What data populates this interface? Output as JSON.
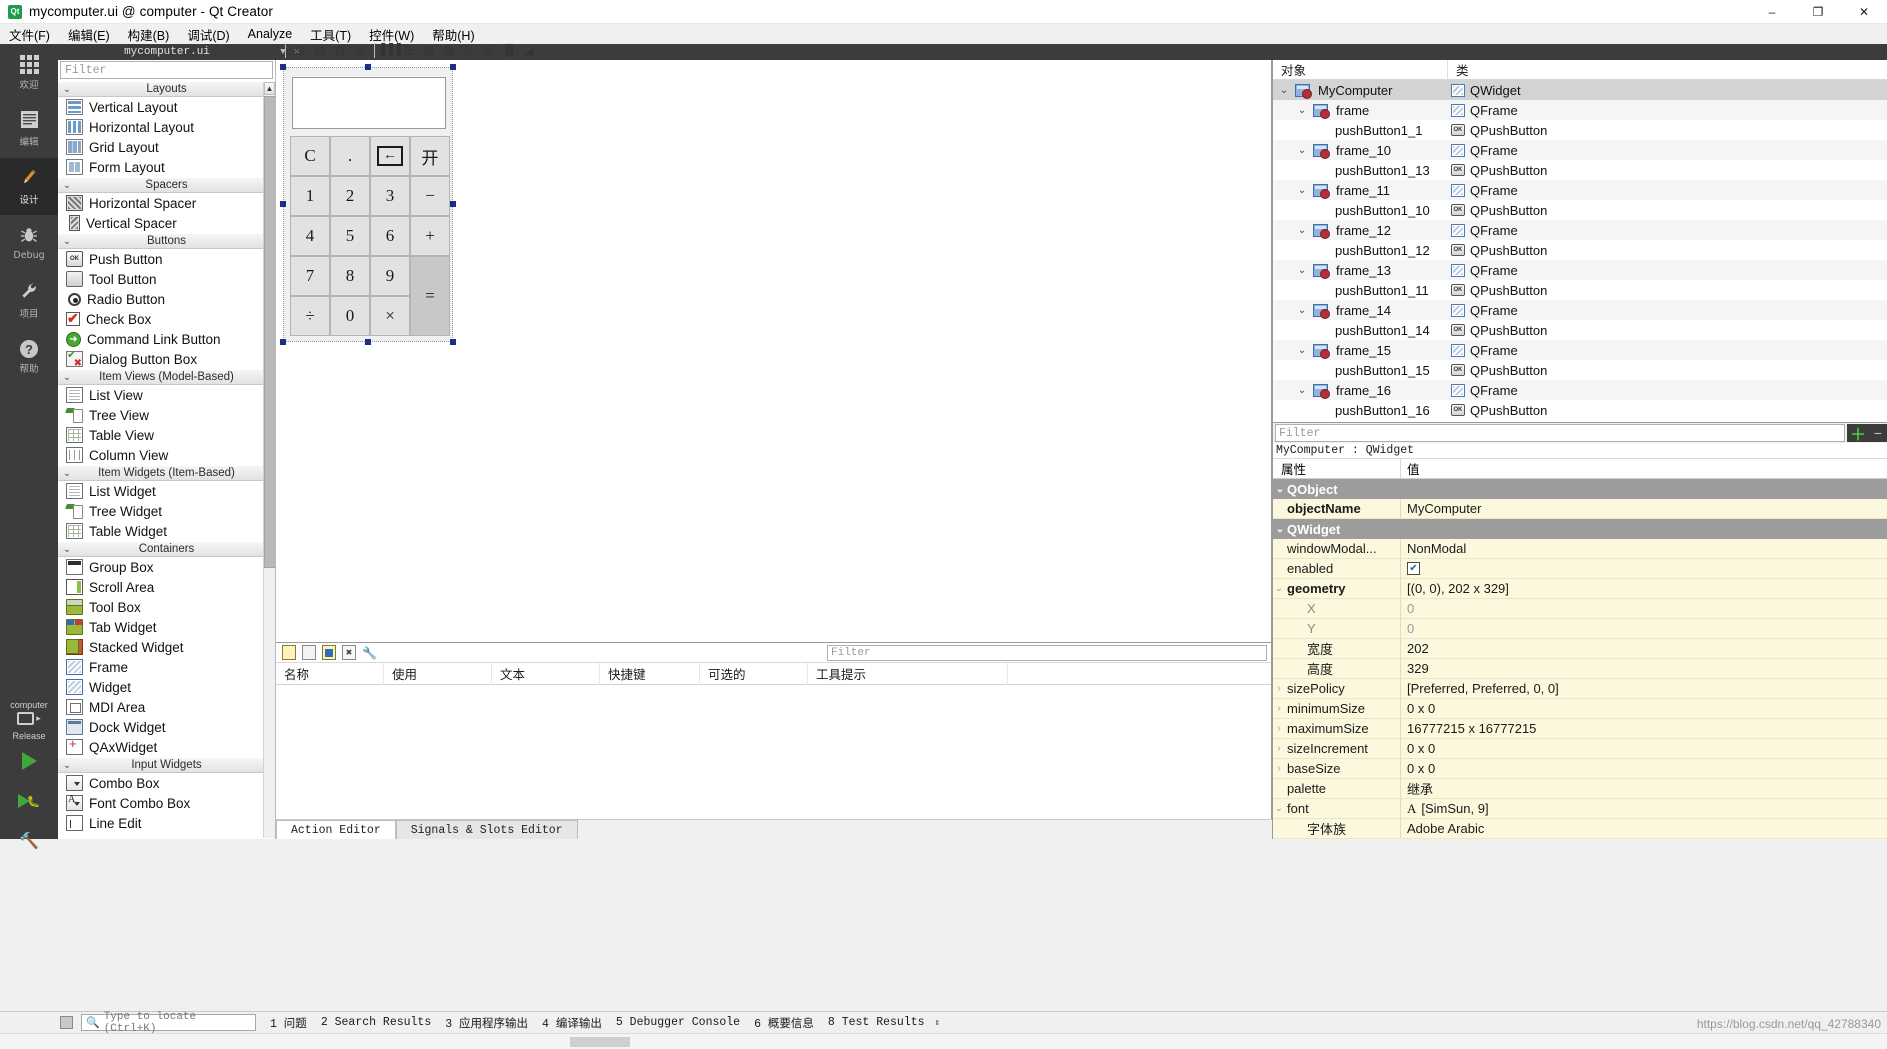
{
  "window": {
    "title": "mycomputer.ui @ computer - Qt Creator",
    "icon": "qt-creator-icon",
    "minimize": "–",
    "maximize": "❐",
    "close": "✕"
  },
  "menubar": [
    {
      "label": "文件(F)"
    },
    {
      "label": "编辑(E)"
    },
    {
      "label": "构建(B)"
    },
    {
      "label": "调试(D)"
    },
    {
      "label": "Analyze"
    },
    {
      "label": "工具(T)"
    },
    {
      "label": "控件(W)"
    },
    {
      "label": "帮助(H)"
    }
  ],
  "modebar": [
    {
      "label": "欢迎",
      "icon": "grid-icon"
    },
    {
      "label": "编辑",
      "icon": "lines-icon"
    },
    {
      "label": "设计",
      "icon": "pencil-icon",
      "active": true
    },
    {
      "label": "Debug",
      "icon": "bug-icon"
    },
    {
      "label": "项目",
      "icon": "wrench-icon"
    },
    {
      "label": "帮助",
      "icon": "question-icon"
    }
  ],
  "kit": {
    "project": "computer",
    "build_config": "Release",
    "run_icon": "run-triangle-icon",
    "debug_icon": "debug-run-icon",
    "build_icon": "hammer-icon"
  },
  "editor_tab": {
    "filename": "mycomputer.ui",
    "dropdown": "▼",
    "close": "✕"
  },
  "designer_toolbar": [
    {
      "name": "edit-widgets-icon",
      "glyph": "▤"
    },
    {
      "name": "edit-signals-slots-icon",
      "glyph": "▨"
    },
    {
      "name": "edit-buddies-icon",
      "glyph": "▧"
    },
    {
      "name": "edit-tab-order-icon",
      "glyph": "②"
    },
    {
      "name": "layout-horizontal-icon",
      "glyph": "▐▐▐"
    },
    {
      "name": "layout-vertical-icon",
      "glyph": "☰"
    },
    {
      "name": "layout-splitter-h-icon",
      "glyph": "▥"
    },
    {
      "name": "layout-splitter-v-icon",
      "glyph": "▤"
    },
    {
      "name": "layout-form-icon",
      "glyph": "░"
    },
    {
      "name": "layout-grid-icon",
      "glyph": "▒"
    },
    {
      "name": "break-layout-icon",
      "glyph": "▓"
    },
    {
      "name": "adjust-size-icon",
      "glyph": "◢"
    }
  ],
  "widgetbox": {
    "filter_placeholder": "Filter",
    "scroll_up": "▲",
    "scroll_down": "▼",
    "categories": [
      {
        "name": "Layouts",
        "chevron": "⌄",
        "items": [
          {
            "label": "Vertical Layout",
            "icon": "vertical-layout-icon",
            "cls": "i-vlayout"
          },
          {
            "label": "Horizontal Layout",
            "icon": "horizontal-layout-icon",
            "cls": "i-hlayout"
          },
          {
            "label": "Grid Layout",
            "icon": "grid-layout-icon",
            "cls": "i-grid"
          },
          {
            "label": "Form Layout",
            "icon": "form-layout-icon",
            "cls": "i-form"
          }
        ]
      },
      {
        "name": "Spacers",
        "chevron": "⌄",
        "items": [
          {
            "label": "Horizontal Spacer",
            "icon": "horizontal-spacer-icon",
            "cls": "i-hspacer"
          },
          {
            "label": "Vertical Spacer",
            "icon": "vertical-spacer-icon",
            "cls": "i-vspacer"
          }
        ]
      },
      {
        "name": "Buttons",
        "chevron": "⌄",
        "items": [
          {
            "label": "Push Button",
            "icon": "push-button-icon",
            "cls": "i-push",
            "text": "OK"
          },
          {
            "label": "Tool Button",
            "icon": "tool-button-icon",
            "cls": "i-tool"
          },
          {
            "label": "Radio Button",
            "icon": "radio-button-icon",
            "cls": "i-radio"
          },
          {
            "label": "Check Box",
            "icon": "check-box-icon",
            "cls": "i-check"
          },
          {
            "label": "Command Link Button",
            "icon": "command-link-button-icon",
            "cls": "i-cmd",
            "text": "➜"
          },
          {
            "label": "Dialog Button Box",
            "icon": "dialog-button-box-icon",
            "cls": "i-dbb"
          }
        ]
      },
      {
        "name": "Item Views (Model-Based)",
        "chevron": "⌄",
        "items": [
          {
            "label": "List View",
            "icon": "list-view-icon",
            "cls": "i-listview"
          },
          {
            "label": "Tree View",
            "icon": "tree-view-icon",
            "cls": "i-treeview"
          },
          {
            "label": "Table View",
            "icon": "table-view-icon",
            "cls": "i-tableview"
          },
          {
            "label": "Column View",
            "icon": "column-view-icon",
            "cls": "i-colview"
          }
        ]
      },
      {
        "name": "Item Widgets (Item-Based)",
        "chevron": "⌄",
        "items": [
          {
            "label": "List Widget",
            "icon": "list-widget-icon",
            "cls": "i-listview"
          },
          {
            "label": "Tree Widget",
            "icon": "tree-widget-icon",
            "cls": "i-treeview"
          },
          {
            "label": "Table Widget",
            "icon": "table-widget-icon",
            "cls": "i-tableview"
          }
        ]
      },
      {
        "name": "Containers",
        "chevron": "⌄",
        "items": [
          {
            "label": "Group Box",
            "icon": "group-box-icon",
            "cls": "i-groupbox"
          },
          {
            "label": "Scroll Area",
            "icon": "scroll-area-icon",
            "cls": "i-scroll"
          },
          {
            "label": "Tool Box",
            "icon": "tool-box-icon",
            "cls": "i-toolbox"
          },
          {
            "label": "Tab Widget",
            "icon": "tab-widget-icon",
            "cls": "i-tabwidget"
          },
          {
            "label": "Stacked Widget",
            "icon": "stacked-widget-icon",
            "cls": "i-stacked"
          },
          {
            "label": "Frame",
            "icon": "frame-icon",
            "cls": "i-frame"
          },
          {
            "label": "Widget",
            "icon": "widget-icon",
            "cls": "i-frame"
          },
          {
            "label": "MDI Area",
            "icon": "mdi-area-icon",
            "cls": "i-mdi"
          },
          {
            "label": "Dock Widget",
            "icon": "dock-widget-icon",
            "cls": "i-dock"
          },
          {
            "label": "QAxWidget",
            "icon": "qax-widget-icon",
            "cls": "i-qax"
          }
        ]
      },
      {
        "name": "Input Widgets",
        "chevron": "⌄",
        "items": [
          {
            "label": "Combo Box",
            "icon": "combo-box-icon",
            "cls": "i-combo"
          },
          {
            "label": "Font Combo Box",
            "icon": "font-combo-box-icon",
            "cls": "i-fontcombo"
          },
          {
            "label": "Line Edit",
            "icon": "line-edit-icon",
            "cls": "i-lineedit"
          }
        ]
      }
    ]
  },
  "canvas": {
    "form_name": "MyComputer",
    "display_value": "",
    "keypad": [
      {
        "label": "C",
        "name": "clear-button"
      },
      {
        "label": ".",
        "name": "dot-button"
      },
      {
        "label": "←",
        "name": "backspace-button",
        "style": "bk"
      },
      {
        "label": "开",
        "name": "on-button"
      },
      {
        "label": "1",
        "name": "digit-1-button"
      },
      {
        "label": "2",
        "name": "digit-2-button"
      },
      {
        "label": "3",
        "name": "digit-3-button"
      },
      {
        "label": "−",
        "name": "minus-button"
      },
      {
        "label": "4",
        "name": "digit-4-button"
      },
      {
        "label": "5",
        "name": "digit-5-button"
      },
      {
        "label": "6",
        "name": "digit-6-button"
      },
      {
        "label": "+",
        "name": "plus-button"
      },
      {
        "label": "7",
        "name": "digit-7-button"
      },
      {
        "label": "8",
        "name": "digit-8-button"
      },
      {
        "label": "9",
        "name": "digit-9-button"
      },
      {
        "label": "=",
        "name": "equals-button",
        "style": "eq"
      },
      {
        "label": "÷",
        "name": "divide-button"
      },
      {
        "label": "0",
        "name": "digit-0-button"
      },
      {
        "label": "×",
        "name": "multiply-button"
      }
    ]
  },
  "action_editor": {
    "toolbar": [
      {
        "name": "new-action-icon",
        "cls": "ico-newpage"
      },
      {
        "name": "copy-action-icon",
        "cls": "ico-copypage"
      },
      {
        "name": "edit-action-icon",
        "cls": "ico-editpage"
      },
      {
        "name": "delete-action-icon",
        "cls": "ico-delpage"
      }
    ],
    "config_icon": "wrench-icon",
    "filter_placeholder": "Filter",
    "columns": [
      "名称",
      "使用",
      "文本",
      "快捷键",
      "可选的",
      "工具提示"
    ],
    "tabs": [
      {
        "label": "Action Editor",
        "active": true
      },
      {
        "label": "Signals & Slots Editor",
        "active": false
      }
    ]
  },
  "object_inspector": {
    "columns": [
      "对象",
      "类"
    ],
    "rows": [
      {
        "name": "MyComputer",
        "class": "QWidget",
        "indent": 0,
        "chevron": "⌄",
        "icon": "form-icon",
        "class_icon": "widget-icon",
        "selected": true
      },
      {
        "name": "frame",
        "class": "QFrame",
        "indent": 1,
        "chevron": "⌄",
        "icon": "form-icon",
        "class_icon": "widget-icon"
      },
      {
        "name": "pushButton1_1",
        "class": "QPushButton",
        "indent": 2,
        "chevron": "",
        "icon": "",
        "class_icon": "push-button-icon"
      },
      {
        "name": "frame_10",
        "class": "QFrame",
        "indent": 1,
        "chevron": "⌄",
        "icon": "form-icon",
        "class_icon": "widget-icon"
      },
      {
        "name": "pushButton1_13",
        "class": "QPushButton",
        "indent": 2,
        "chevron": "",
        "icon": "",
        "class_icon": "push-button-icon"
      },
      {
        "name": "frame_11",
        "class": "QFrame",
        "indent": 1,
        "chevron": "⌄",
        "icon": "form-icon",
        "class_icon": "widget-icon"
      },
      {
        "name": "pushButton1_10",
        "class": "QPushButton",
        "indent": 2,
        "chevron": "",
        "icon": "",
        "class_icon": "push-button-icon"
      },
      {
        "name": "frame_12",
        "class": "QFrame",
        "indent": 1,
        "chevron": "⌄",
        "icon": "form-icon",
        "class_icon": "widget-icon"
      },
      {
        "name": "pushButton1_12",
        "class": "QPushButton",
        "indent": 2,
        "chevron": "",
        "icon": "",
        "class_icon": "push-button-icon"
      },
      {
        "name": "frame_13",
        "class": "QFrame",
        "indent": 1,
        "chevron": "⌄",
        "icon": "form-icon",
        "class_icon": "widget-icon"
      },
      {
        "name": "pushButton1_11",
        "class": "QPushButton",
        "indent": 2,
        "chevron": "",
        "icon": "",
        "class_icon": "push-button-icon"
      },
      {
        "name": "frame_14",
        "class": "QFrame",
        "indent": 1,
        "chevron": "⌄",
        "icon": "form-icon",
        "class_icon": "widget-icon"
      },
      {
        "name": "pushButton1_14",
        "class": "QPushButton",
        "indent": 2,
        "chevron": "",
        "icon": "",
        "class_icon": "push-button-icon"
      },
      {
        "name": "frame_15",
        "class": "QFrame",
        "indent": 1,
        "chevron": "⌄",
        "icon": "form-icon",
        "class_icon": "widget-icon"
      },
      {
        "name": "pushButton1_15",
        "class": "QPushButton",
        "indent": 2,
        "chevron": "",
        "icon": "",
        "class_icon": "push-button-icon"
      },
      {
        "name": "frame_16",
        "class": "QFrame",
        "indent": 1,
        "chevron": "⌄",
        "icon": "form-icon",
        "class_icon": "widget-icon"
      },
      {
        "name": "pushButton1_16",
        "class": "QPushButton",
        "indent": 2,
        "chevron": "",
        "icon": "",
        "class_icon": "push-button-icon"
      }
    ]
  },
  "property_editor": {
    "filter_placeholder": "Filter",
    "add_label": "＋",
    "remove_label": "−",
    "object_line": "MyComputer : QWidget",
    "columns": [
      "属性",
      "值"
    ],
    "rows": [
      {
        "kind": "group",
        "name": "QObject",
        "chevron": "⌄"
      },
      {
        "kind": "prop",
        "name": "objectName",
        "value": "MyComputer",
        "bold": true,
        "chevron": ""
      },
      {
        "kind": "group",
        "name": "QWidget",
        "chevron": "⌄"
      },
      {
        "kind": "prop",
        "name": "windowModal...",
        "value": "NonModal",
        "chevron": ""
      },
      {
        "kind": "check",
        "name": "enabled",
        "value": "✔",
        "chevron": ""
      },
      {
        "kind": "prop",
        "name": "geometry",
        "value": "[(0, 0), 202 x 329]",
        "bold": true,
        "chevron": "⌄"
      },
      {
        "kind": "sub",
        "name": "X",
        "value": "0",
        "gray": true
      },
      {
        "kind": "sub",
        "name": "Y",
        "value": "0",
        "gray": true
      },
      {
        "kind": "sub2",
        "name": "宽度",
        "value": "202"
      },
      {
        "kind": "sub2",
        "name": "高度",
        "value": "329"
      },
      {
        "kind": "prop",
        "name": "sizePolicy",
        "value": "[Preferred, Preferred, 0, 0]",
        "chevron": "›"
      },
      {
        "kind": "prop",
        "name": "minimumSize",
        "value": "0 x 0",
        "chevron": "›"
      },
      {
        "kind": "prop",
        "name": "maximumSize",
        "value": "16777215 x 16777215",
        "chevron": "›"
      },
      {
        "kind": "prop",
        "name": "sizeIncrement",
        "value": "0 x 0",
        "chevron": "›"
      },
      {
        "kind": "prop",
        "name": "baseSize",
        "value": "0 x 0",
        "chevron": "›"
      },
      {
        "kind": "prop",
        "name": "palette",
        "value": "继承",
        "chevron": ""
      },
      {
        "kind": "font",
        "name": "font",
        "value": "[SimSun, 9]",
        "chevron": "⌄"
      },
      {
        "kind": "sub2",
        "name": "字体族",
        "value": "Adobe Arabic"
      }
    ]
  },
  "statusbar": {
    "locate_placeholder": "Type to locate (Ctrl+K)",
    "search_icon": "magnifier-icon",
    "items": [
      "1 问题",
      "2 Search Results",
      "3 应用程序输出",
      "4 编译输出",
      "5 Debugger Console",
      "6 概要信息",
      "8 Test Results"
    ],
    "expand_arrow": "⇕"
  },
  "watermark": "https://blog.csdn.net/qq_42788340"
}
